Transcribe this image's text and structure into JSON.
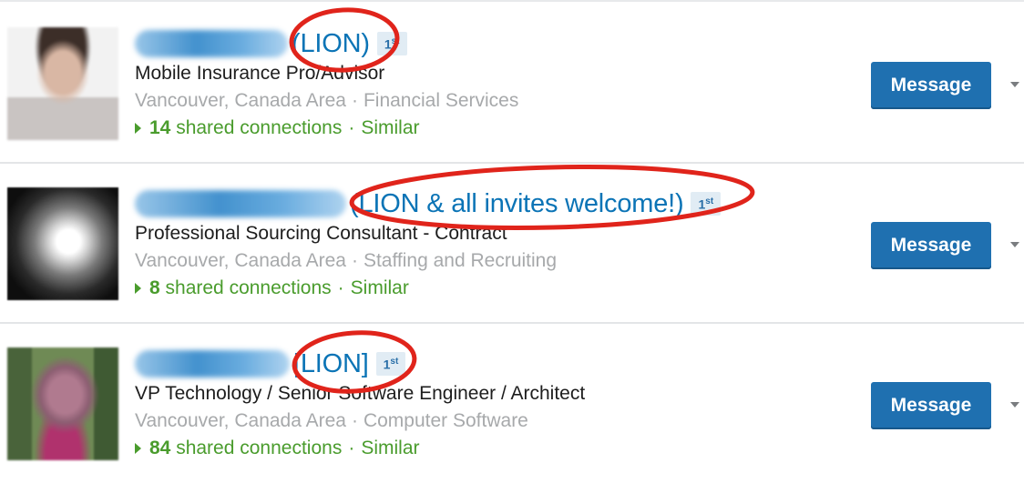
{
  "results": [
    {
      "name_visible_part": "(LION)",
      "degree": "1",
      "degree_suffix": "st",
      "headline": "Mobile Insurance Pro/Advisor",
      "location": "Vancouver, Canada Area",
      "industry": "Financial Services",
      "shared_count": "14",
      "shared_label": "shared connections",
      "similar_label": "Similar",
      "message_label": "Message"
    },
    {
      "name_visible_part": "(LION & all invites welcome!)",
      "degree": "1",
      "degree_suffix": "st",
      "headline": "Professional Sourcing Consultant - Contract",
      "location": "Vancouver, Canada Area",
      "industry": "Staffing and Recruiting",
      "shared_count": "8",
      "shared_label": "shared connections",
      "similar_label": "Similar",
      "message_label": "Message"
    },
    {
      "name_visible_part": "[LION]",
      "degree": "1",
      "degree_suffix": "st",
      "headline": "VP Technology / Senior Software Engineer / Architect",
      "location": "Vancouver, Canada Area",
      "industry": "Computer Software",
      "shared_count": "84",
      "shared_label": "shared connections",
      "similar_label": "Similar",
      "message_label": "Message"
    }
  ],
  "separator": "·",
  "colors": {
    "link_blue": "#0b74b6",
    "button_blue": "#1f70b0",
    "shared_green": "#4a9c2d",
    "muted_gray": "#a7a9ab",
    "annotation_red": "#e0241b"
  },
  "icons": {
    "expand": "caret-right-icon",
    "more": "chevron-down-icon"
  }
}
